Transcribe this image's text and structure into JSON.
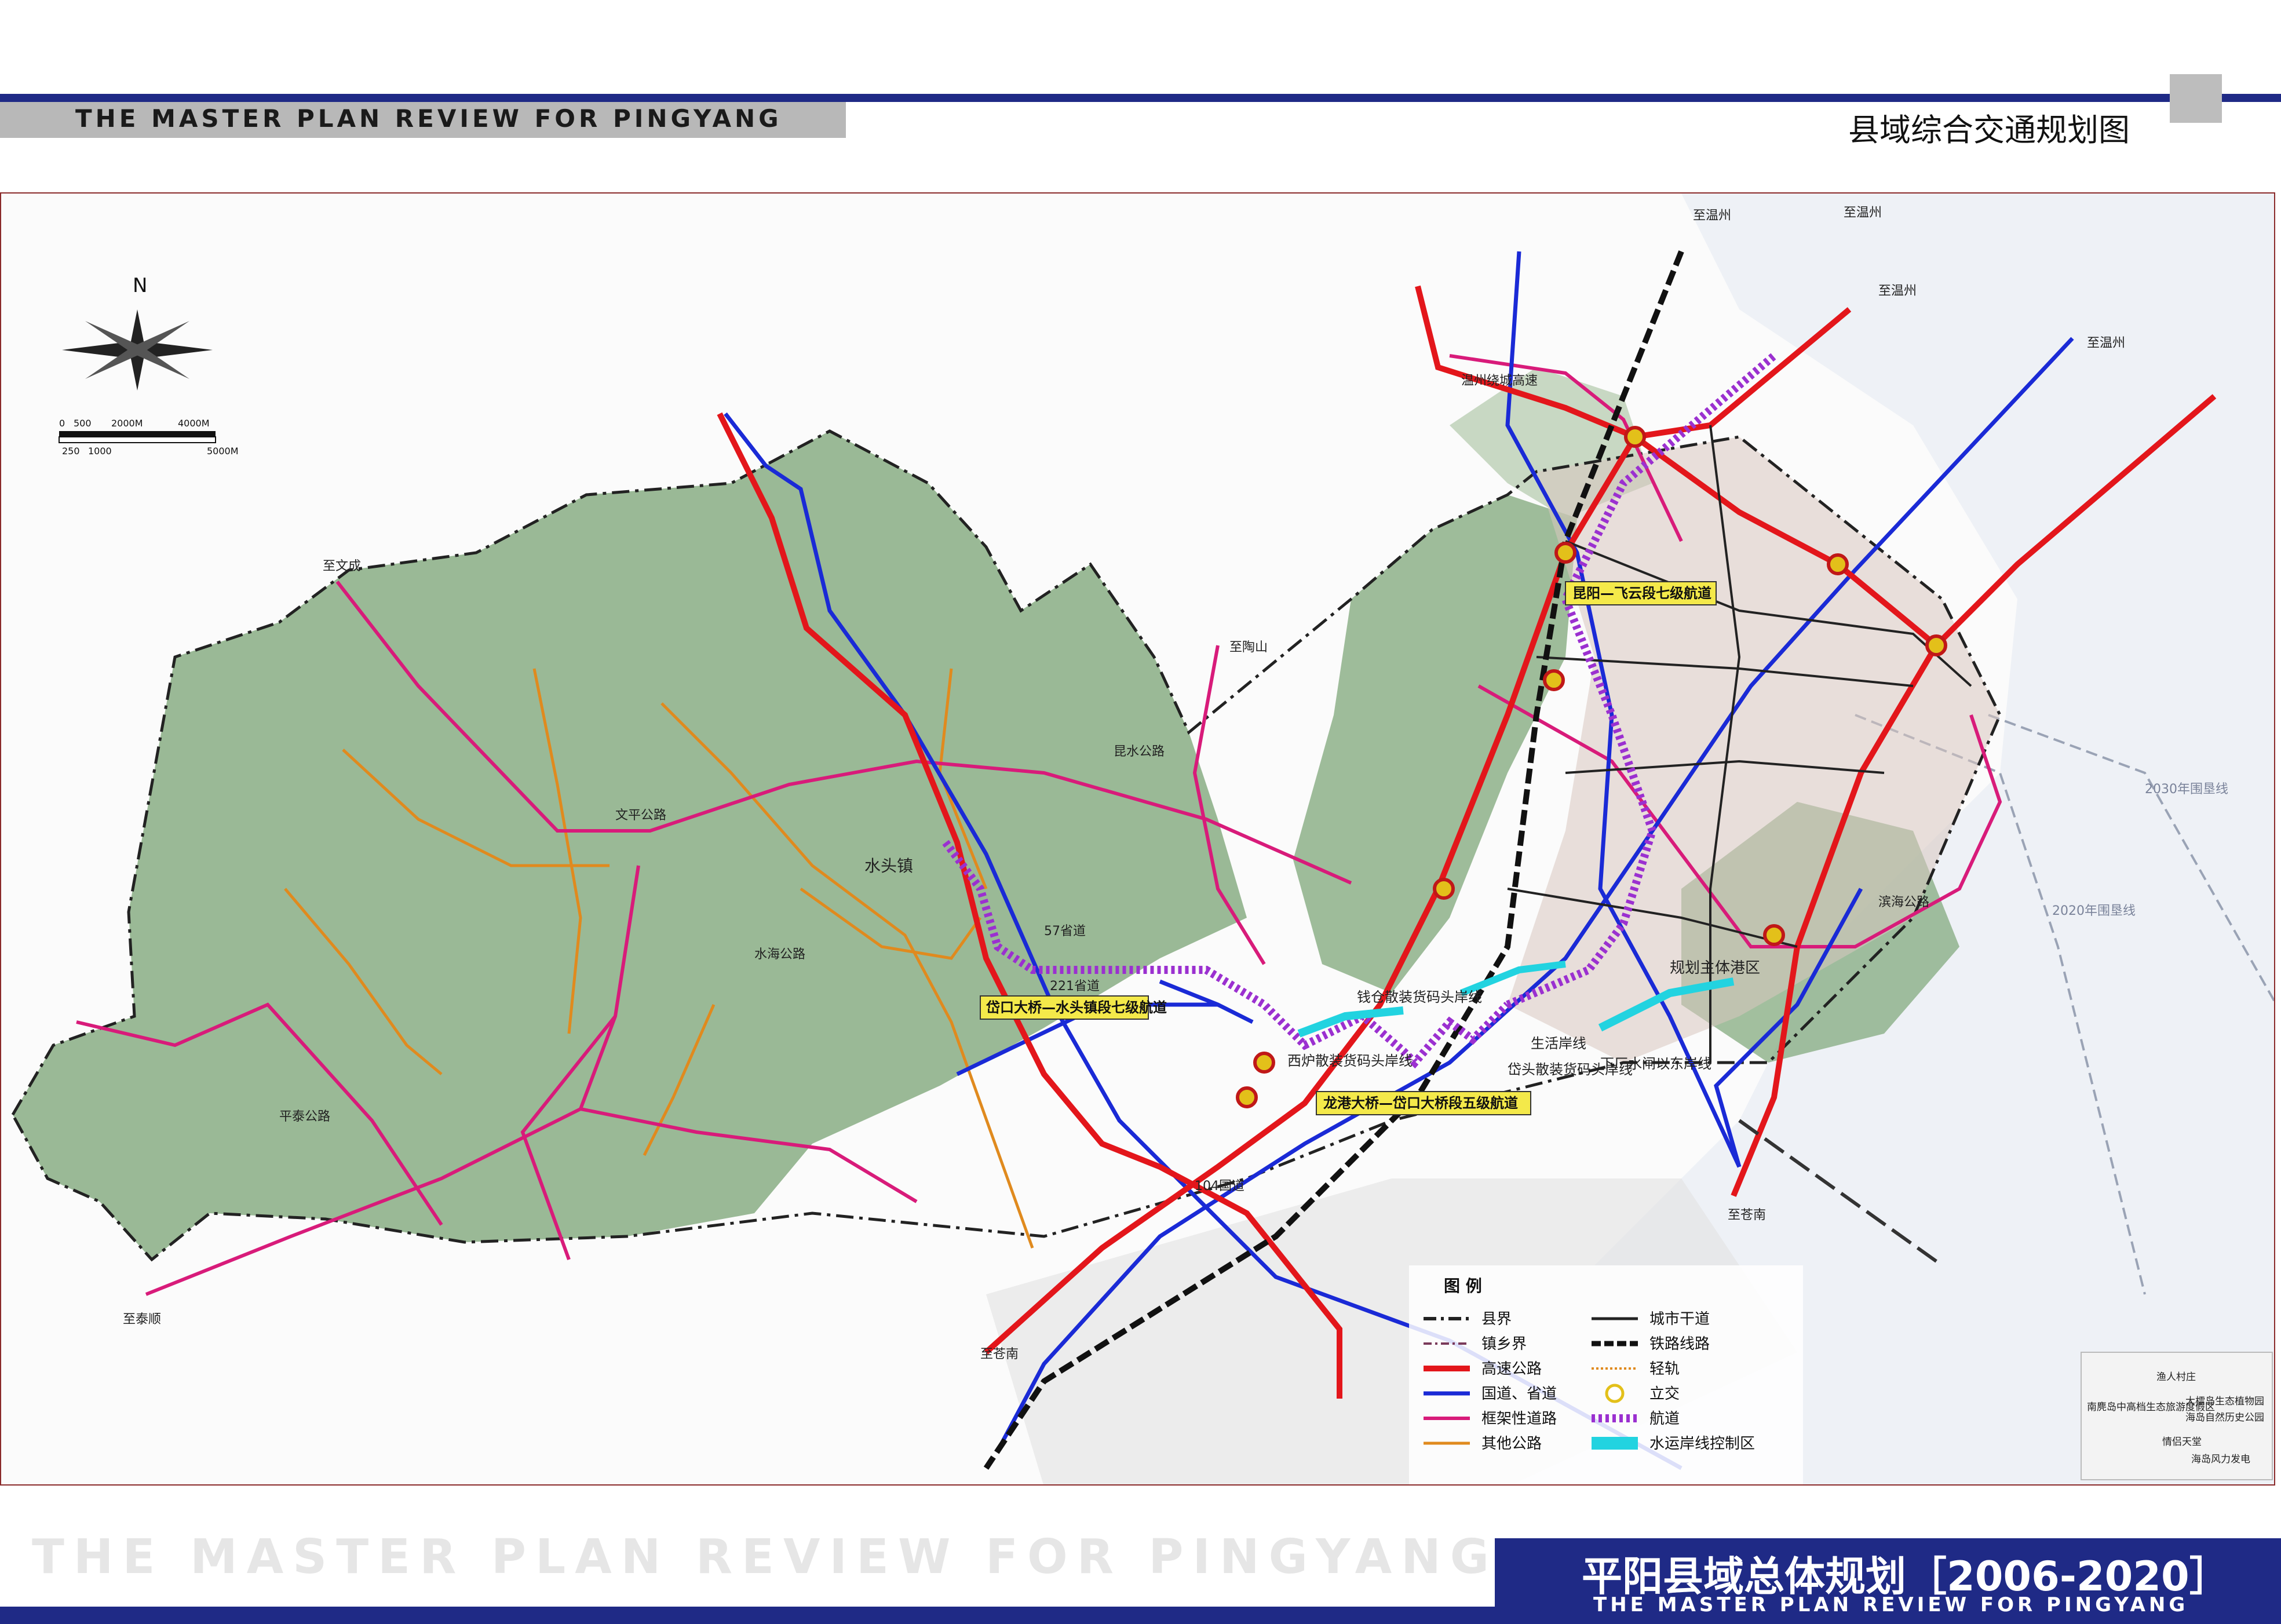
{
  "header": {
    "title_en": "THE MASTER PLAN REVIEW FOR PINGYANG",
    "sheet_title": "县域综合交通规划图"
  },
  "footer": {
    "ghost_title": "THE MASTER PLAN REVIEW FOR PINGYANG",
    "title_cn": "平阳县域总体规划［2006-2020］",
    "title_en": "THE MASTER PLAN REVIEW FOR PINGYANG"
  },
  "compass": {
    "letter": "N"
  },
  "scale_bar": {
    "top_ticks": [
      "0",
      "500",
      "2000M",
      "4000M"
    ],
    "bottom_ticks": [
      "250",
      "1000",
      "5000M"
    ]
  },
  "colors": {
    "expressway": "#e3161b",
    "national_road": "#1a2ad6",
    "frame_road": "#d81b7a",
    "other_road": "#e08a1e",
    "waterway": "#9b30d0",
    "shoreline": "#22d3e0",
    "terrain": "#6f9a6a",
    "brand": "#1f2a86"
  },
  "map_labels": {
    "town_shuitou": "水头镇",
    "waterway_kunyang": "昆阳—飞云段七级航道",
    "waterway_daikou": "岱口大桥—水头镇段七级航道",
    "waterway_longgang": "龙港大桥—岱口大桥段五级航道",
    "port_area": "规划主体港区",
    "quay_qianzang": "钱仓散装货码头岸线",
    "quay_xilu": "西炉散装货码头岸线",
    "quay_daitou": "岱头散装货码头岸线",
    "quay_life": "生活岸线",
    "quay_xiachang": "下厂水闸以东岸线",
    "to_wenzhou_1": "至温州",
    "to_wenzhou_2": "至温州",
    "to_wenzhou_3": "至温州",
    "to_wenzhou_4": "至温州",
    "to_wencheng": "至文成",
    "to_taishun": "至泰顺",
    "to_taoshan": "至陶山",
    "to_cangnan_1": "至苍南",
    "to_cangnan_2": "至苍南",
    "road_57": "57省道",
    "road_221": "221省道",
    "road_104": "104国道",
    "road_kunshui": "昆水公路",
    "road_wenzhu": "文平公路",
    "road_shuihai": "水海公路",
    "road_pingtai": "平泰公路",
    "road_binhai": "滨海公路",
    "road_wenzhou_ring": "温州绕城高速",
    "line_2020": "2020年围垦线",
    "line_2030": "2030年围垦线",
    "tourism_1": "渔人村庄",
    "tourism_2": "南麂岛中高档生态旅游度假区",
    "tourism_3": "大檑岛生态植物园",
    "tourism_4": "海岛自然历史公园",
    "tourism_5": "情侣天堂",
    "tourism_6": "海岛风力发电"
  },
  "legend": {
    "title": "图  例",
    "items_left": [
      {
        "label": "县界"
      },
      {
        "label": "镇乡界"
      },
      {
        "label": "高速公路"
      },
      {
        "label": "国道、省道"
      },
      {
        "label": "框架性道路"
      },
      {
        "label": "其他公路"
      }
    ],
    "items_right": [
      {
        "label": "城市干道"
      },
      {
        "label": "铁路线路"
      },
      {
        "label": "轻轨"
      },
      {
        "label": "立交"
      },
      {
        "label": "航道"
      },
      {
        "label": "水运岸线控制区"
      }
    ]
  }
}
